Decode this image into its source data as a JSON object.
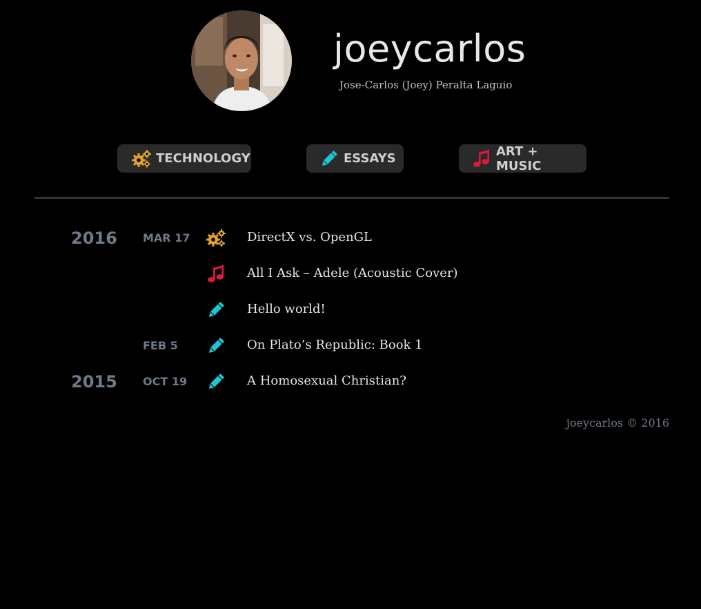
{
  "header": {
    "title": "joeycarlos",
    "subtitle": "Jose-Carlos (Joey) Peralta Laguio"
  },
  "nav": {
    "technology": "TECHNOLOGY",
    "essays": "ESSAYS",
    "art_music": "ART + MUSIC"
  },
  "colors": {
    "technology": "#e0a526",
    "essays": "#1fc5d2",
    "art_music": "#e0173f",
    "muted": "#6e7a88"
  },
  "posts": {
    "year_2016": "2016",
    "year_2015": "2015",
    "items": [
      {
        "date": "MAR 17",
        "category": "technology",
        "icon": "gears-icon",
        "title": "DirectX vs. OpenGL"
      },
      {
        "date": "",
        "category": "art_music",
        "icon": "music-note-icon",
        "title": "All I Ask – Adele (Acoustic Cover)"
      },
      {
        "date": "",
        "category": "essays",
        "icon": "pencil-icon",
        "title": "Hello world!"
      },
      {
        "date": "FEB 5",
        "category": "essays",
        "icon": "pencil-icon",
        "title": "On Plato’s Republic: Book 1"
      },
      {
        "date": "OCT 19",
        "category": "essays",
        "icon": "pencil-icon",
        "title": "A Homosexual Christian?"
      }
    ]
  },
  "footer": {
    "text": "joeycarlos © 2016"
  }
}
